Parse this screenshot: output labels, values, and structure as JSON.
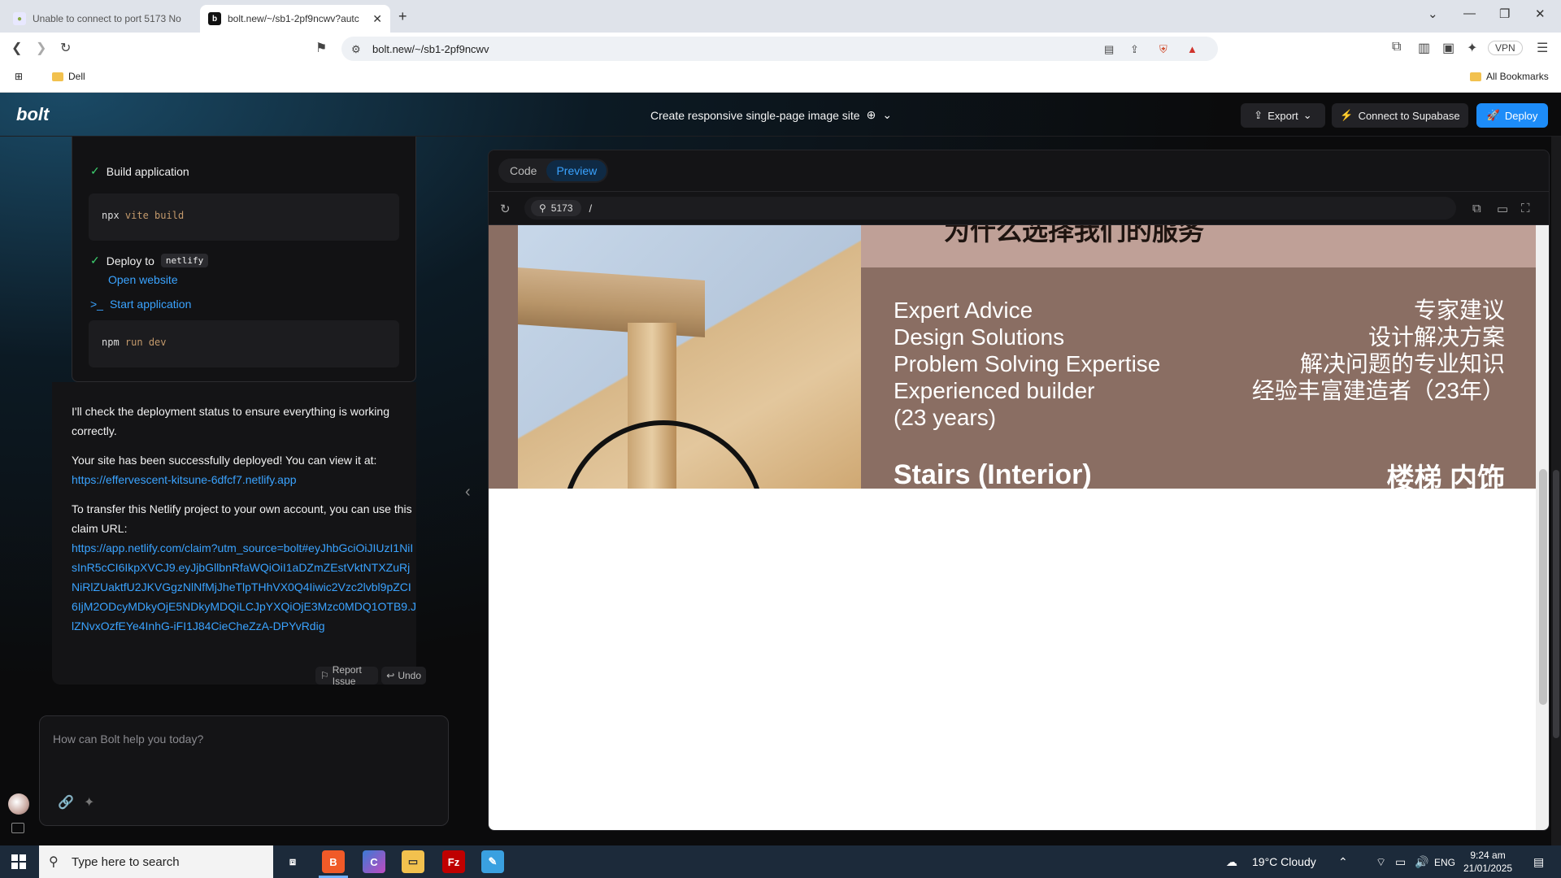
{
  "browser": {
    "tabs": [
      {
        "title": "Unable to connect to port 5173 No",
        "active": false
      },
      {
        "title": "bolt.new/~/sb1-2pf9ncwv?autc",
        "active": true
      }
    ],
    "new_tab": "+",
    "url": "bolt.new/~/sb1-2pf9ncwv",
    "vpn_label": "VPN",
    "bookmarks": [
      {
        "label": "Dell"
      }
    ],
    "all_bookmarks": "All Bookmarks"
  },
  "app": {
    "logo": "bolt",
    "project_title": "Create responsive single-page image site",
    "buttons": {
      "export": "Export",
      "supabase": "Connect to Supabase",
      "deploy": "Deploy"
    }
  },
  "chat": {
    "actions": {
      "build_label": "Build application",
      "build_cmd": "npx",
      "build_args": "vite build",
      "deploy_label": "Deploy to",
      "deploy_target": "netlify",
      "open_website": "Open website",
      "start_label": "Start application",
      "start_cmd": "npm",
      "start_args": "run dev"
    },
    "messages": {
      "check": "I'll check the deployment status to ensure everything is working correctly.",
      "success": "Your site has been successfully deployed! You can view it at:",
      "site_url": "https://effervescent-kitsune-6dfcf7.netlify.app",
      "transfer": "To transfer this Netlify project to your own account, you can use  this claim URL:",
      "claim_url": "https://app.netlify.com/claim?utm_source=bolt#eyJhbGciOiJIUzI1NiIsInR5cCI6IkpXVCJ9.eyJjbGllbnRfaWQiOiI1aDZmZEstVktNTXZuRjNiRlZUaktfU2JKVGgzNlNfMjJheTlpTHhVX0Q4Iiwic2Vzc2lvbl9pZCI6IjM2ODcyMDkyOjE5NDkyMDQiLCJpYXQiOjE3Mzc0MDQ1OTB9.JlZNvxOzfEYe4InhG-iFI1J84CieCheZzA-DPYvRdig"
    },
    "report_issue": "Report Issue",
    "undo": "Undo",
    "prompt_placeholder": "How can Bolt help you today?"
  },
  "workbench": {
    "tabs": [
      {
        "label": "Code",
        "active": false
      },
      {
        "label": "Preview",
        "active": true
      }
    ],
    "port": "5173",
    "path": "/"
  },
  "preview_site": {
    "heading": "为什么选择我们的服务",
    "services_en": [
      "Expert Advice",
      "Design Solutions",
      "Problem Solving Expertise",
      "Experienced builder",
      "(23 years)"
    ],
    "services_zh": [
      "专家建议",
      "设计解决方案",
      "解决问题的专业知识",
      "经验丰富建造者（23年）"
    ],
    "next_en": "Stairs (Interior)",
    "next_zh": "楼梯 内饰"
  },
  "taskbar": {
    "search_placeholder": "Type here to search",
    "weather": "19°C  Cloudy",
    "lang": "ENG",
    "time": "9:24 am",
    "date": "21/01/2025"
  }
}
